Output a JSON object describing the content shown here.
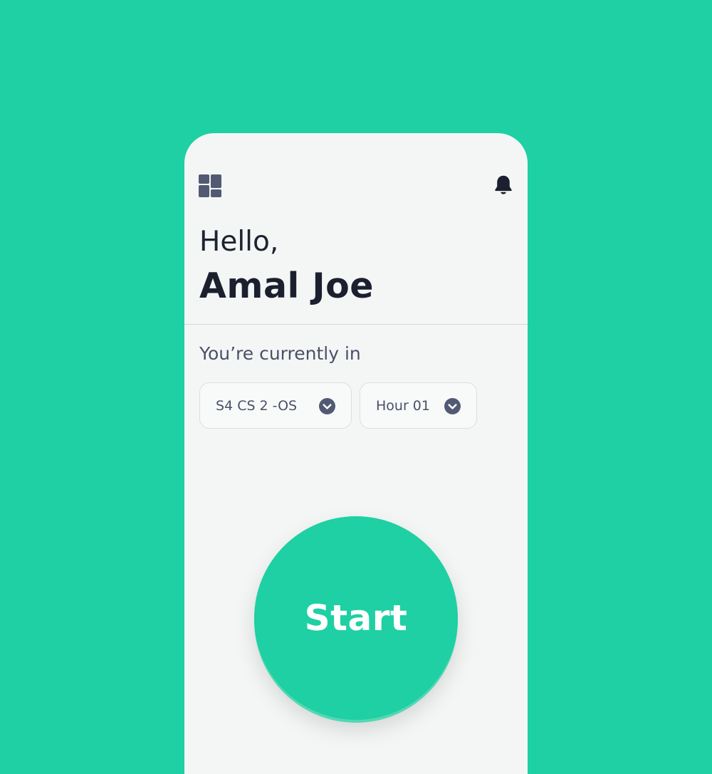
{
  "header": {
    "menu_icon": "dashboard-grid-icon",
    "notification_icon": "bell-icon"
  },
  "greeting": {
    "hello": "Hello,",
    "name": "Amal Joe"
  },
  "session": {
    "label": "You’re currently in",
    "class_select": {
      "value": "S4 CS 2 -OS",
      "icon": "chevron-down-icon"
    },
    "hour_select": {
      "value": "Hour 01",
      "icon": "chevron-down-icon"
    }
  },
  "start_button": {
    "label": "Start"
  },
  "colors": {
    "accent": "#1ed0a3",
    "card_background": "#f3f6f5",
    "icon": "#525a73",
    "text_dark": "#1b1f2e",
    "text_muted": "#4b5068"
  }
}
